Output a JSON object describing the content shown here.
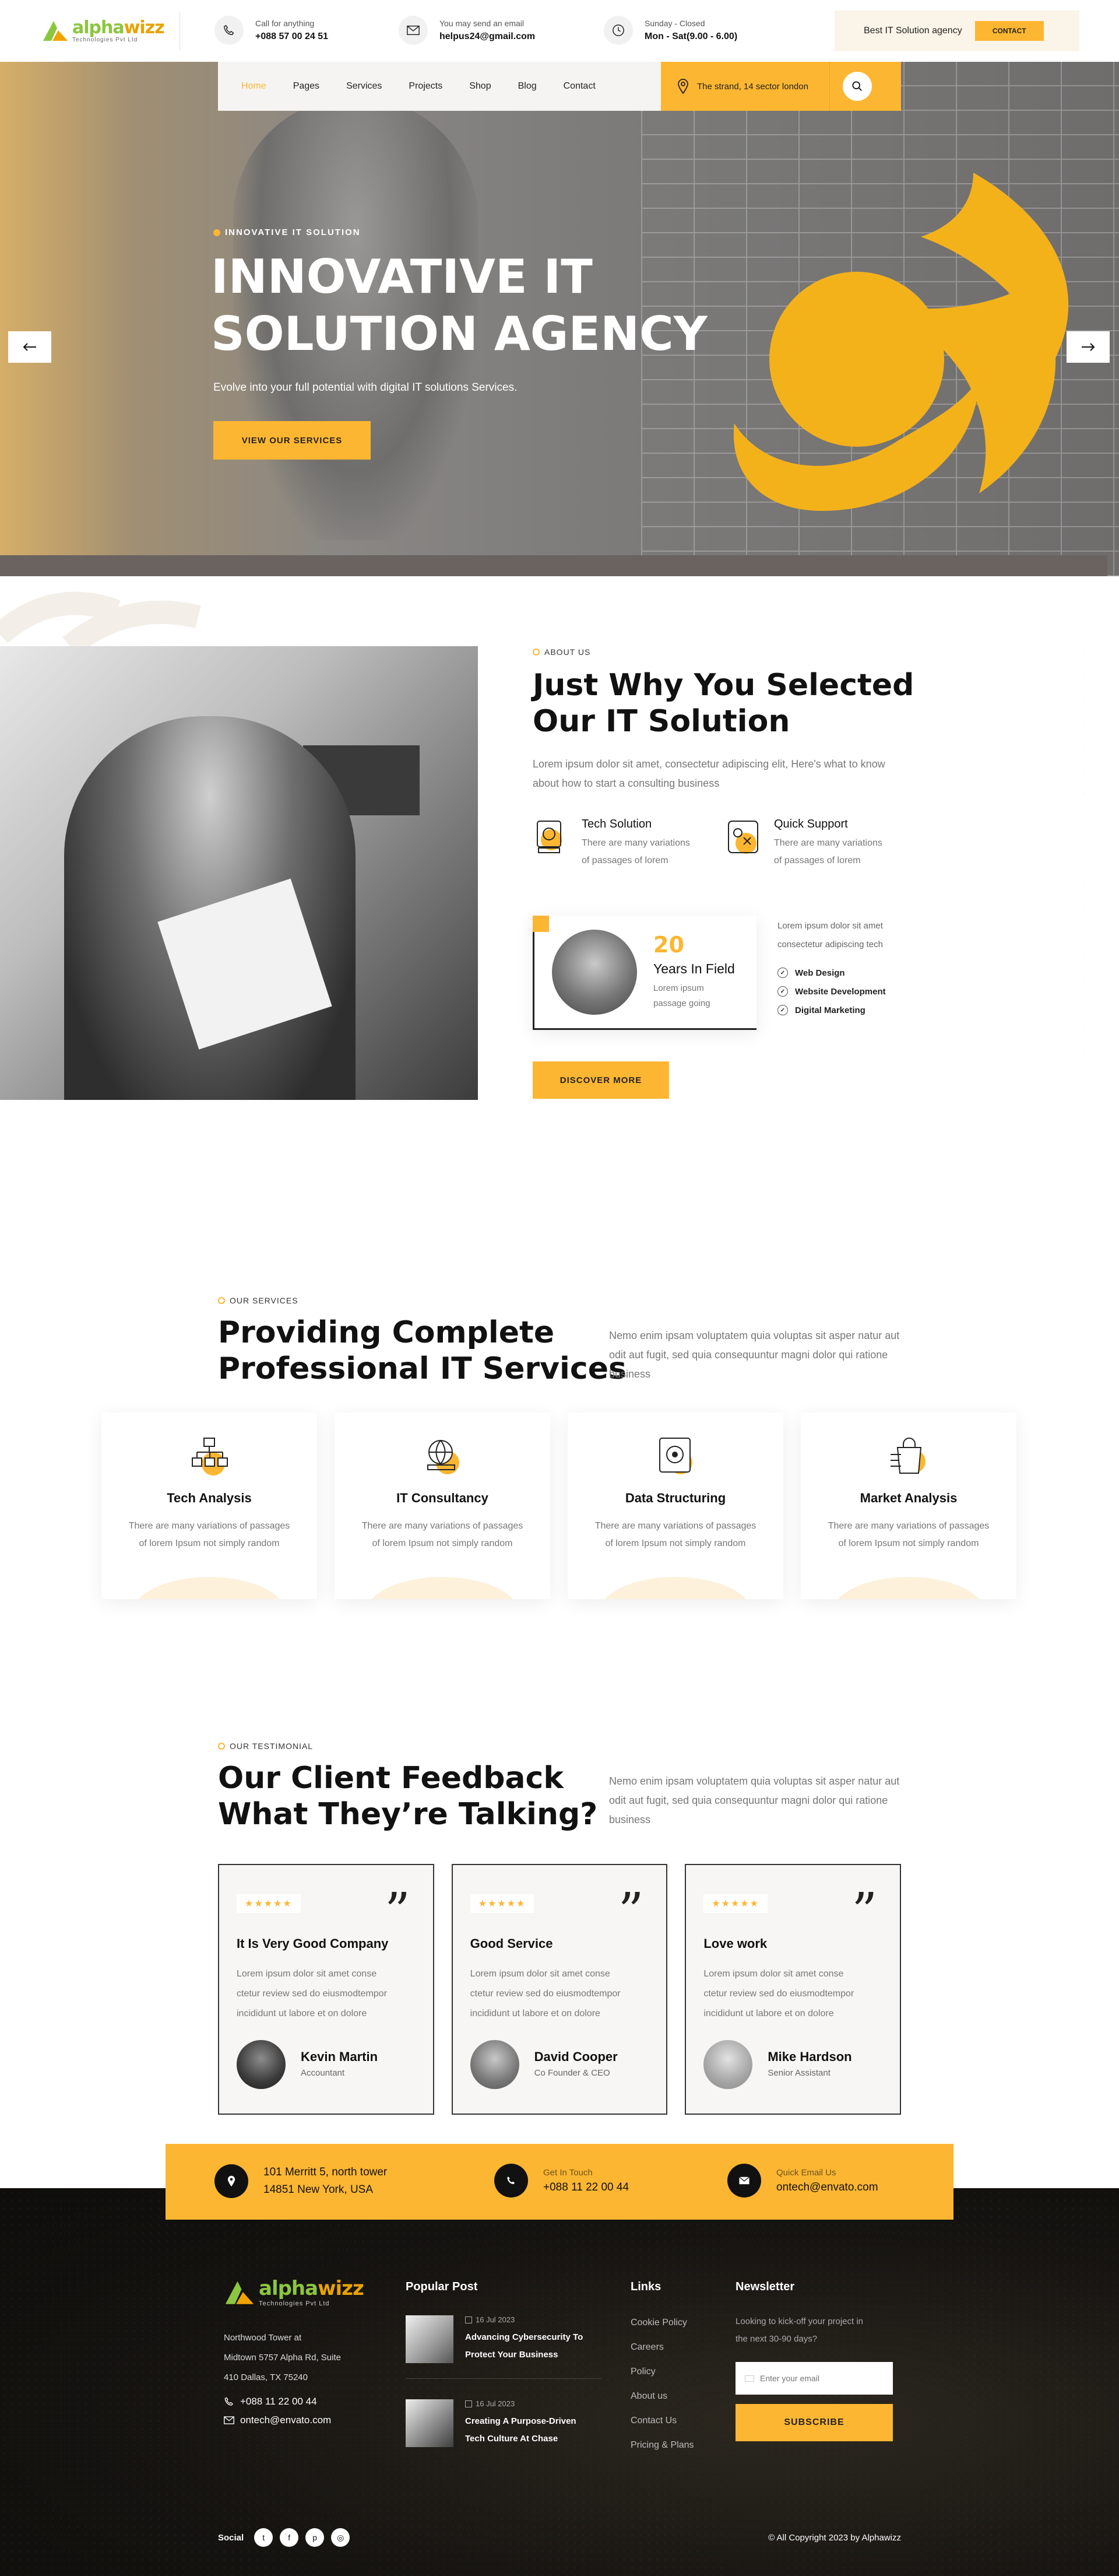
{
  "header": {
    "logo": {
      "name_a": "alpha",
      "name_b": "wizz",
      "tagline": "Technologies Pvt Ltd"
    },
    "call": {
      "label": "Call for anything",
      "value": "+088 57 00 24 51"
    },
    "email": {
      "label": "You may send an email",
      "value": "helpus24@gmail.com"
    },
    "hours": {
      "label": "Sunday - Closed",
      "value": "Mon - Sat(9.00 - 6.00)"
    },
    "promo": {
      "text": "Best IT Solution agency",
      "button": "CONTACT"
    }
  },
  "nav": {
    "items": [
      "Home",
      "Pages",
      "Services",
      "Projects",
      "Shop",
      "Blog",
      "Contact"
    ],
    "active": "Home",
    "address": "The strand, 14 sector london"
  },
  "hero": {
    "tag": "INNOVATIVE IT SOLUTION",
    "title_line1": "INNOVATIVE IT",
    "title_line2": "SOLUTION AGENCY",
    "subtitle": "Evolve into your full potential with digital IT solutions Services.",
    "button": "VIEW OUR SERVICES"
  },
  "about": {
    "tag": "ABOUT US",
    "title_line1": "Just Why You Selected",
    "title_line2": "Our IT Solution",
    "text": "Lorem ipsum dolor sit amet, consectetur adipiscing elit, Here's what to know about how to start a consulting business",
    "features": [
      {
        "title": "Tech Solution",
        "desc_line1": "There are many variations",
        "desc_line2": "of passages of lorem",
        "icon": "tech-solution-icon"
      },
      {
        "title": "Quick Support",
        "desc_line1": "There are many variations",
        "desc_line2": "of passages of lorem",
        "icon": "quick-support-icon"
      }
    ],
    "years": {
      "number": "20",
      "label": "Years In Field",
      "desc_line1": "Lorem ipsum",
      "desc_line2": "passage going"
    },
    "list_intro_line1": "Lorem ipsum dolor sit amet",
    "list_intro_line2": "consectetur adipiscing tech",
    "list": [
      "Web Design",
      "Website Development",
      "Digital Marketing"
    ],
    "button": "DISCOVER MORE"
  },
  "services": {
    "tag": "OUR SERVICES",
    "title_line1": "Providing Complete",
    "title_line2": "Professional IT Services",
    "text": "Nemo enim ipsam voluptatem quia voluptas sit asper natur aut odit aut fugit, sed quia consequuntur magni dolor qui ratione business",
    "cards": [
      {
        "title": "Tech Analysis",
        "desc_line1": "There are many variations of passages",
        "desc_line2": "of lorem Ipsum not simply random",
        "icon": "tech-analysis-icon"
      },
      {
        "title": "IT Consultancy",
        "desc_line1": "There are many variations of passages",
        "desc_line2": "of lorem Ipsum not simply random",
        "icon": "it-consultancy-icon"
      },
      {
        "title": "Data Structuring",
        "desc_line1": "There are many variations of passages",
        "desc_line2": "of lorem Ipsum not simply random",
        "icon": "data-structuring-icon"
      },
      {
        "title": "Market Analysis",
        "desc_line1": "There are many variations of passages",
        "desc_line2": "of lorem Ipsum not simply random",
        "icon": "market-analysis-icon"
      }
    ]
  },
  "testimonials": {
    "tag": "OUR TESTIMONIAL",
    "title_line1": "Our Client Feedback",
    "title_line2": "What They’re Talking?",
    "text": "Nemo enim ipsam voluptatem quia voluptas sit asper natur aut odit aut fugit, sed quia consequuntur magni dolor qui ratione business",
    "stars": "★★★★★",
    "items": [
      {
        "title": "It Is Very Good Company",
        "l1": "Lorem ipsum dolor sit amet conse",
        "l2": "ctetur review sed do eiusmodtempor",
        "l3": "incididunt ut labore et on dolore",
        "name": "Kevin Martin",
        "role": "Accountant"
      },
      {
        "title": "Good Service",
        "l1": "Lorem ipsum dolor sit amet conse",
        "l2": "ctetur review sed do eiusmodtempor",
        "l3": "incididunt ut labore et on dolore",
        "name": "David Cooper",
        "role": "Co Founder & CEO"
      },
      {
        "title": "Love work",
        "l1": "Lorem ipsum dolor sit amet conse",
        "l2": "ctetur review sed do eiusmodtempor",
        "l3": "incididunt ut labore et on dolore",
        "name": "Mike Hardson",
        "role": "Senior Assistant"
      }
    ]
  },
  "contact_bar": {
    "address_line1": "101 Merritt 5, north tower",
    "address_line2": "14851 New York, USA",
    "phone_label": "Get In Touch",
    "phone": "+088 11 22 00 44",
    "email_label": "Quick Email Us",
    "email": "ontech@envato.com"
  },
  "footer": {
    "address_line1": "Northwood Tower at",
    "address_line2": "Midtown 5757 Alpha Rd, Suite",
    "address_line3": "410 Dallas, TX 75240",
    "phone": "+088 11 22 00 44",
    "email": "ontech@envato.com",
    "popular_title": "Popular Post",
    "posts": [
      {
        "date": "16 Jul 2023",
        "title_line1": "Advancing Cybersecurity To",
        "title_line2": "Protect Your Business"
      },
      {
        "date": "16 Jul 2023",
        "title_line1": "Creating A Purpose-Driven",
        "title_line2": "Tech Culture At Chase"
      }
    ],
    "links_title": "Links",
    "links": [
      "Cookie Policy",
      "Careers",
      "Policy",
      "About us",
      "Contact Us",
      "Pricing & Plans"
    ],
    "newsletter_title": "Newsletter",
    "newsletter_text_line1": "Looking to kick-off your project in",
    "newsletter_text_line2": "the next 30-90 days?",
    "email_placeholder": "Enter your email",
    "subscribe": "SUBSCRIBE",
    "social_label": "Social",
    "copyright": "© All Copyright 2023 by Alphawizz"
  },
  "colors": {
    "accent": "#fdb631",
    "brand_green": "#8cc63f",
    "dark": "#111111"
  }
}
